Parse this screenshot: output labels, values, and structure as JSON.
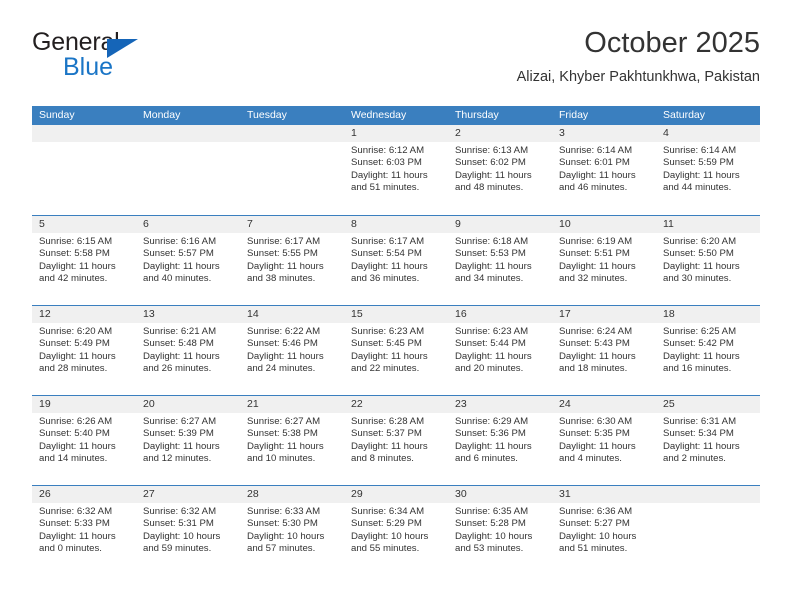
{
  "brand": {
    "name_top": "General",
    "name_bottom": "Blue",
    "triangle_icon": "triangle-icon",
    "color_blue": "#1a75c6",
    "color_dark": "#231f20"
  },
  "header": {
    "title": "October 2025",
    "subtitle": "Alizai, Khyber Pakhtunkhwa, Pakistan"
  },
  "theme": {
    "header_bg": "#3a7fbf",
    "header_text": "#ffffff",
    "daynum_bg": "#f0f0f0",
    "body_text": "#333333"
  },
  "calendar": {
    "weekdays": [
      "Sunday",
      "Monday",
      "Tuesday",
      "Wednesday",
      "Thursday",
      "Friday",
      "Saturday"
    ],
    "weeks": [
      [
        {
          "day": "",
          "lines": []
        },
        {
          "day": "",
          "lines": []
        },
        {
          "day": "",
          "lines": []
        },
        {
          "day": "1",
          "lines": [
            "Sunrise: 6:12 AM",
            "Sunset: 6:03 PM",
            "Daylight: 11 hours",
            "and 51 minutes."
          ]
        },
        {
          "day": "2",
          "lines": [
            "Sunrise: 6:13 AM",
            "Sunset: 6:02 PM",
            "Daylight: 11 hours",
            "and 48 minutes."
          ]
        },
        {
          "day": "3",
          "lines": [
            "Sunrise: 6:14 AM",
            "Sunset: 6:01 PM",
            "Daylight: 11 hours",
            "and 46 minutes."
          ]
        },
        {
          "day": "4",
          "lines": [
            "Sunrise: 6:14 AM",
            "Sunset: 5:59 PM",
            "Daylight: 11 hours",
            "and 44 minutes."
          ]
        }
      ],
      [
        {
          "day": "5",
          "lines": [
            "Sunrise: 6:15 AM",
            "Sunset: 5:58 PM",
            "Daylight: 11 hours",
            "and 42 minutes."
          ]
        },
        {
          "day": "6",
          "lines": [
            "Sunrise: 6:16 AM",
            "Sunset: 5:57 PM",
            "Daylight: 11 hours",
            "and 40 minutes."
          ]
        },
        {
          "day": "7",
          "lines": [
            "Sunrise: 6:17 AM",
            "Sunset: 5:55 PM",
            "Daylight: 11 hours",
            "and 38 minutes."
          ]
        },
        {
          "day": "8",
          "lines": [
            "Sunrise: 6:17 AM",
            "Sunset: 5:54 PM",
            "Daylight: 11 hours",
            "and 36 minutes."
          ]
        },
        {
          "day": "9",
          "lines": [
            "Sunrise: 6:18 AM",
            "Sunset: 5:53 PM",
            "Daylight: 11 hours",
            "and 34 minutes."
          ]
        },
        {
          "day": "10",
          "lines": [
            "Sunrise: 6:19 AM",
            "Sunset: 5:51 PM",
            "Daylight: 11 hours",
            "and 32 minutes."
          ]
        },
        {
          "day": "11",
          "lines": [
            "Sunrise: 6:20 AM",
            "Sunset: 5:50 PM",
            "Daylight: 11 hours",
            "and 30 minutes."
          ]
        }
      ],
      [
        {
          "day": "12",
          "lines": [
            "Sunrise: 6:20 AM",
            "Sunset: 5:49 PM",
            "Daylight: 11 hours",
            "and 28 minutes."
          ]
        },
        {
          "day": "13",
          "lines": [
            "Sunrise: 6:21 AM",
            "Sunset: 5:48 PM",
            "Daylight: 11 hours",
            "and 26 minutes."
          ]
        },
        {
          "day": "14",
          "lines": [
            "Sunrise: 6:22 AM",
            "Sunset: 5:46 PM",
            "Daylight: 11 hours",
            "and 24 minutes."
          ]
        },
        {
          "day": "15",
          "lines": [
            "Sunrise: 6:23 AM",
            "Sunset: 5:45 PM",
            "Daylight: 11 hours",
            "and 22 minutes."
          ]
        },
        {
          "day": "16",
          "lines": [
            "Sunrise: 6:23 AM",
            "Sunset: 5:44 PM",
            "Daylight: 11 hours",
            "and 20 minutes."
          ]
        },
        {
          "day": "17",
          "lines": [
            "Sunrise: 6:24 AM",
            "Sunset: 5:43 PM",
            "Daylight: 11 hours",
            "and 18 minutes."
          ]
        },
        {
          "day": "18",
          "lines": [
            "Sunrise: 6:25 AM",
            "Sunset: 5:42 PM",
            "Daylight: 11 hours",
            "and 16 minutes."
          ]
        }
      ],
      [
        {
          "day": "19",
          "lines": [
            "Sunrise: 6:26 AM",
            "Sunset: 5:40 PM",
            "Daylight: 11 hours",
            "and 14 minutes."
          ]
        },
        {
          "day": "20",
          "lines": [
            "Sunrise: 6:27 AM",
            "Sunset: 5:39 PM",
            "Daylight: 11 hours",
            "and 12 minutes."
          ]
        },
        {
          "day": "21",
          "lines": [
            "Sunrise: 6:27 AM",
            "Sunset: 5:38 PM",
            "Daylight: 11 hours",
            "and 10 minutes."
          ]
        },
        {
          "day": "22",
          "lines": [
            "Sunrise: 6:28 AM",
            "Sunset: 5:37 PM",
            "Daylight: 11 hours",
            "and 8 minutes."
          ]
        },
        {
          "day": "23",
          "lines": [
            "Sunrise: 6:29 AM",
            "Sunset: 5:36 PM",
            "Daylight: 11 hours",
            "and 6 minutes."
          ]
        },
        {
          "day": "24",
          "lines": [
            "Sunrise: 6:30 AM",
            "Sunset: 5:35 PM",
            "Daylight: 11 hours",
            "and 4 minutes."
          ]
        },
        {
          "day": "25",
          "lines": [
            "Sunrise: 6:31 AM",
            "Sunset: 5:34 PM",
            "Daylight: 11 hours",
            "and 2 minutes."
          ]
        }
      ],
      [
        {
          "day": "26",
          "lines": [
            "Sunrise: 6:32 AM",
            "Sunset: 5:33 PM",
            "Daylight: 11 hours",
            "and 0 minutes."
          ]
        },
        {
          "day": "27",
          "lines": [
            "Sunrise: 6:32 AM",
            "Sunset: 5:31 PM",
            "Daylight: 10 hours",
            "and 59 minutes."
          ]
        },
        {
          "day": "28",
          "lines": [
            "Sunrise: 6:33 AM",
            "Sunset: 5:30 PM",
            "Daylight: 10 hours",
            "and 57 minutes."
          ]
        },
        {
          "day": "29",
          "lines": [
            "Sunrise: 6:34 AM",
            "Sunset: 5:29 PM",
            "Daylight: 10 hours",
            "and 55 minutes."
          ]
        },
        {
          "day": "30",
          "lines": [
            "Sunrise: 6:35 AM",
            "Sunset: 5:28 PM",
            "Daylight: 10 hours",
            "and 53 minutes."
          ]
        },
        {
          "day": "31",
          "lines": [
            "Sunrise: 6:36 AM",
            "Sunset: 5:27 PM",
            "Daylight: 10 hours",
            "and 51 minutes."
          ]
        },
        {
          "day": "",
          "lines": []
        }
      ]
    ]
  }
}
